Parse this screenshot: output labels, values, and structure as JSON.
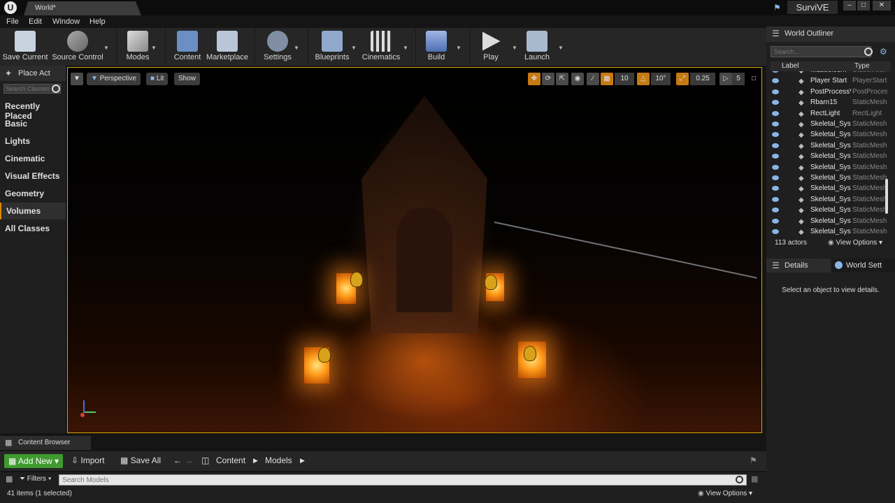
{
  "window": {
    "doc_tab": "World*",
    "project": "SurviVE"
  },
  "menu": [
    "File",
    "Edit",
    "Window",
    "Help"
  ],
  "toolbar": {
    "save_current": "Save Current",
    "source_control": "Source Control",
    "modes": "Modes",
    "content": "Content",
    "marketplace": "Marketplace",
    "settings": "Settings",
    "blueprints": "Blueprints",
    "cinematics": "Cinematics",
    "build": "Build",
    "play": "Play",
    "launch": "Launch"
  },
  "place_panel": {
    "tab": "Place Act",
    "search_placeholder": "Search Classes",
    "categories": [
      "Recently Placed",
      "Basic",
      "Lights",
      "Cinematic",
      "Visual Effects",
      "Geometry",
      "Volumes",
      "All Classes"
    ],
    "active_category": "Volumes"
  },
  "viewport": {
    "perspective": "Perspective",
    "lit": "Lit",
    "show": "Show",
    "grid_snap": "10",
    "rotation_snap": "10°",
    "scale_snap": "0.25",
    "camera_speed": "5"
  },
  "outliner": {
    "tab": "World Outliner",
    "search_placeholder": "Search...",
    "col_label": "Label",
    "col_type": "Type",
    "rows": [
      {
        "name": "Mausoleum",
        "type": "StaticMesh"
      },
      {
        "name": "Player Start",
        "type": "PlayerStart"
      },
      {
        "name": "PostProcessVolume",
        "type": "PostProcessVolume"
      },
      {
        "name": "Rbarn15",
        "type": "StaticMesh"
      },
      {
        "name": "RectLight",
        "type": "RectLight"
      },
      {
        "name": "Skeletal_System",
        "type": "StaticMesh"
      },
      {
        "name": "Skeletal_System",
        "type": "StaticMesh"
      },
      {
        "name": "Skeletal_System",
        "type": "StaticMesh"
      },
      {
        "name": "Skeletal_System",
        "type": "StaticMesh"
      },
      {
        "name": "Skeletal_System",
        "type": "StaticMesh"
      },
      {
        "name": "Skeletal_System",
        "type": "StaticMesh"
      },
      {
        "name": "Skeletal_System",
        "type": "StaticMesh"
      },
      {
        "name": "Skeletal_System",
        "type": "StaticMesh"
      },
      {
        "name": "Skeletal_System",
        "type": "StaticMesh"
      },
      {
        "name": "Skeletal_System",
        "type": "StaticMesh"
      },
      {
        "name": "Skeletal_System",
        "type": "StaticMesh"
      }
    ],
    "actor_count": "113 actors",
    "view_options": "View Options"
  },
  "details": {
    "tab": "Details",
    "world_settings_tab": "World Sett",
    "empty_message": "Select an object to view details."
  },
  "content_browser": {
    "tab": "Content Browser",
    "add_new": "Add New",
    "import": "Import",
    "save_all": "Save All",
    "path": [
      "Content",
      "Models"
    ],
    "filters": "Filters",
    "search_placeholder": "Search Models",
    "status": "41 items (1 selected)",
    "view_options": "View Options"
  },
  "colors": {
    "accent": "#d6a200",
    "add_new": "#3f9a2f",
    "selection_bar": "#d88a00"
  }
}
